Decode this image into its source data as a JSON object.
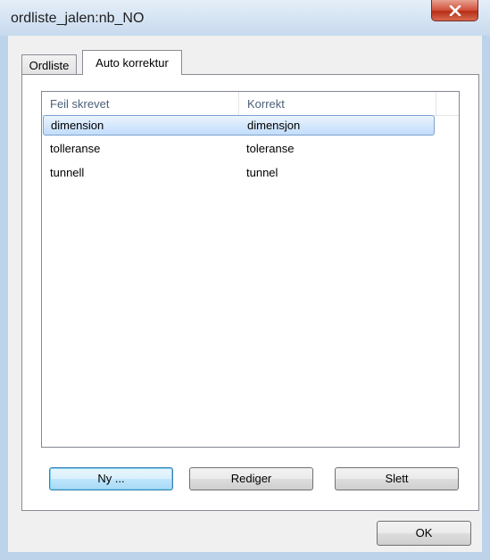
{
  "window": {
    "title": "ordliste_jalen:nb_NO",
    "close_label": "X"
  },
  "tabs": [
    {
      "label": "Ordliste",
      "active": false
    },
    {
      "label": "Auto korrektur",
      "active": true
    }
  ],
  "list": {
    "columns": [
      "Feil skrevet",
      "Korrekt",
      ""
    ],
    "rows": [
      {
        "wrong": "dimension",
        "correct": "dimensjon",
        "selected": true
      },
      {
        "wrong": "tolleranse",
        "correct": "toleranse",
        "selected": false
      },
      {
        "wrong": "tunnell",
        "correct": "tunnel",
        "selected": false
      }
    ]
  },
  "buttons": {
    "new": "Ny ...",
    "edit": "Rediger",
    "delete": "Slett",
    "ok": "OK"
  },
  "colors": {
    "selection": "#c1dcfc",
    "close_button": "#c8452d",
    "frame": "#bcd3ea"
  }
}
